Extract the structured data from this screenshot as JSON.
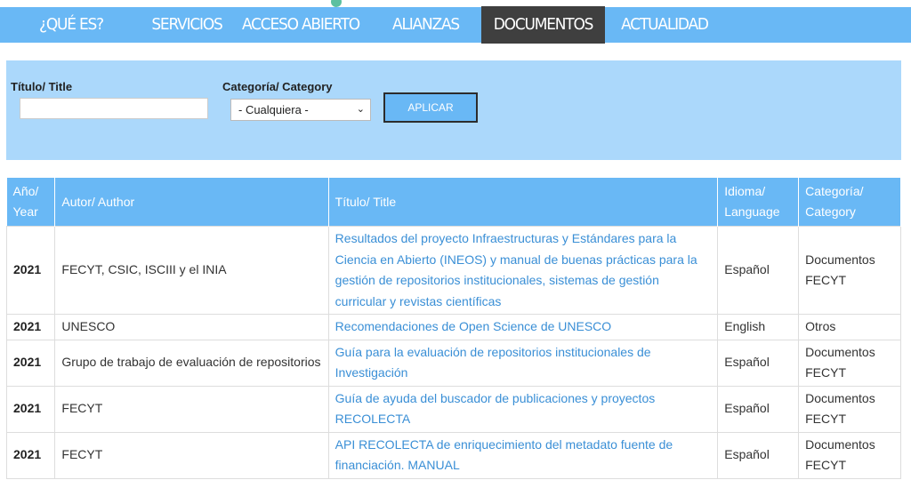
{
  "nav": {
    "items": [
      {
        "label": "¿QUÉ ES?",
        "width": 160,
        "active": false
      },
      {
        "label": "SERVICIOS",
        "width": 100,
        "active": false
      },
      {
        "label": "ACCESO ABIERTO",
        "width": 156,
        "active": false
      },
      {
        "label": "ALIANZAS FECYT",
        "width": 125,
        "active": false
      },
      {
        "label": "DOCUMENTOS",
        "width": 139,
        "active": true
      },
      {
        "label": "ACTUALIDAD",
        "width": 134,
        "active": false
      }
    ]
  },
  "filter": {
    "title_label": "Título/ Title",
    "title_value": "",
    "category_label": "Categoría/ Category",
    "category_selected": "- Cualquiera -",
    "apply_label": "APLICAR"
  },
  "table": {
    "headers": [
      "Año/ Year",
      "Autor/ Author",
      "Título/ Title",
      "Idioma/ Language",
      "Categoría/ Category"
    ],
    "rows": [
      {
        "year": "2021",
        "author": "FECYT, CSIC, ISCIII y el INIA",
        "title": "Resultados del proyecto Infraestructuras y Estándares para la Ciencia en Abierto (INEOS) y manual de buenas prácticas para la gestión de repositorios institucionales, sistemas de gestión curricular y revistas científicas",
        "language": "Español",
        "category": "Documentos FECYT"
      },
      {
        "year": "2021",
        "author": "UNESCO",
        "title": "Recomendaciones de Open Science de UNESCO",
        "language": "English",
        "category": "Otros"
      },
      {
        "year": "2021",
        "author": "Grupo de trabajo de evaluación de repositorios",
        "title": "Guía para la evaluación de repositorios institucionales de Investigación",
        "language": "Español",
        "category": "Documentos FECYT"
      },
      {
        "year": "2021",
        "author": "FECYT",
        "title": "Guía de ayuda del buscador de publicaciones y proyectos RECOLECTA",
        "language": "Español",
        "category": "Documentos FECYT"
      },
      {
        "year": "2021",
        "author": "FECYT",
        "title": "API RECOLECTA de enriquecimiento del metadato fuente de financiación. MANUAL",
        "language": "Español",
        "category": "Documentos FECYT"
      }
    ]
  }
}
